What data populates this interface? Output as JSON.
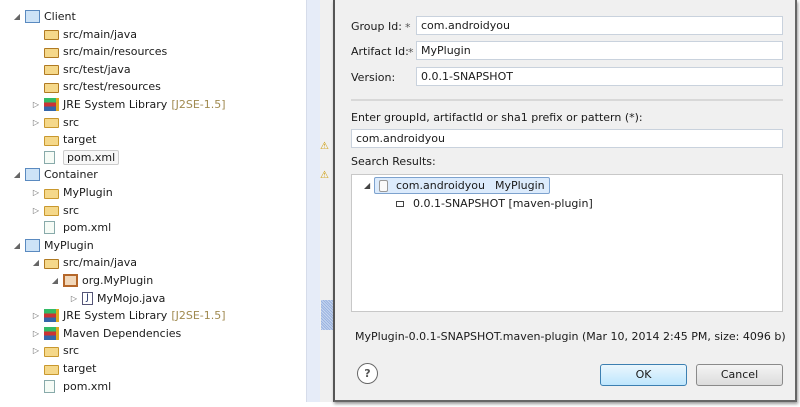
{
  "explorer": {
    "items": [
      {
        "label": "Client",
        "suffix": "",
        "icon": "maven-project-icon",
        "toggle": "expanded",
        "level": 0
      },
      {
        "label": "src/main/java",
        "suffix": "",
        "icon": "source-folder-icon",
        "toggle": "",
        "level": 1
      },
      {
        "label": "src/main/resources",
        "suffix": "",
        "icon": "source-folder-icon",
        "toggle": "",
        "level": 1
      },
      {
        "label": "src/test/java",
        "suffix": "",
        "icon": "source-folder-icon",
        "toggle": "",
        "level": 1
      },
      {
        "label": "src/test/resources",
        "suffix": "",
        "icon": "source-folder-icon",
        "toggle": "",
        "level": 1
      },
      {
        "label": "JRE System Library",
        "suffix": "[J2SE-1.5]",
        "icon": "library-icon",
        "toggle": "collapsed",
        "level": 1
      },
      {
        "label": "src",
        "suffix": "",
        "icon": "folder-icon",
        "toggle": "collapsed",
        "level": 1
      },
      {
        "label": "target",
        "suffix": "",
        "icon": "folder-icon",
        "toggle": "",
        "level": 1
      },
      {
        "label": "pom.xml",
        "suffix": "",
        "icon": "xml-file-icon",
        "toggle": "",
        "level": 1,
        "selected": true
      },
      {
        "label": "Container",
        "suffix": "",
        "icon": "maven-project-icon",
        "toggle": "expanded",
        "level": 0
      },
      {
        "label": "MyPlugin",
        "suffix": "",
        "icon": "folder-icon",
        "toggle": "collapsed",
        "level": 1
      },
      {
        "label": "src",
        "suffix": "",
        "icon": "folder-icon",
        "toggle": "collapsed",
        "level": 1
      },
      {
        "label": "pom.xml",
        "suffix": "",
        "icon": "xml-file-icon",
        "toggle": "",
        "level": 1
      },
      {
        "label": "MyPlugin",
        "suffix": "",
        "icon": "maven-project-icon",
        "toggle": "expanded",
        "level": 0
      },
      {
        "label": "src/main/java",
        "suffix": "",
        "icon": "source-folder-icon",
        "toggle": "expanded",
        "level": 1
      },
      {
        "label": "org.MyPlugin",
        "suffix": "",
        "icon": "package-icon",
        "toggle": "expanded",
        "level": 2
      },
      {
        "label": "MyMojo.java",
        "suffix": "",
        "icon": "java-file-icon",
        "toggle": "collapsed",
        "level": 3
      },
      {
        "label": "JRE System Library",
        "suffix": "[J2SE-1.5]",
        "icon": "library-icon",
        "toggle": "collapsed",
        "level": 1
      },
      {
        "label": "Maven Dependencies",
        "suffix": "",
        "icon": "library-icon",
        "toggle": "collapsed",
        "level": 1
      },
      {
        "label": "src",
        "suffix": "",
        "icon": "folder-icon",
        "toggle": "collapsed",
        "level": 1
      },
      {
        "label": "target",
        "suffix": "",
        "icon": "folder-icon",
        "toggle": "",
        "level": 1
      },
      {
        "label": "pom.xml",
        "suffix": "",
        "icon": "xml-file-icon",
        "toggle": "",
        "level": 1
      }
    ]
  },
  "dialog": {
    "group_label": "Group Id:",
    "group_value": "com.androidyou",
    "artifact_label": "Artifact Id:",
    "artifact_value": "MyPlugin",
    "version_label": "Version:",
    "version_value": "0.0.1-SNAPSHOT",
    "required_mark": "*",
    "search_label": "Enter groupId, artifactId or sha1 prefix or pattern (*):",
    "search_value": "com.androidyou",
    "results_label": "Search Results:",
    "result_group": "com.androidyou",
    "result_artifact": "MyPlugin",
    "result_version": "0.0.1-SNAPSHOT [maven-plugin]",
    "status": "MyPlugin-0.0.1-SNAPSHOT.maven-plugin (Mar 10, 2014 2:45 PM, size: 4096 b)",
    "help": "?",
    "ok": "OK",
    "cancel": "Cancel"
  }
}
